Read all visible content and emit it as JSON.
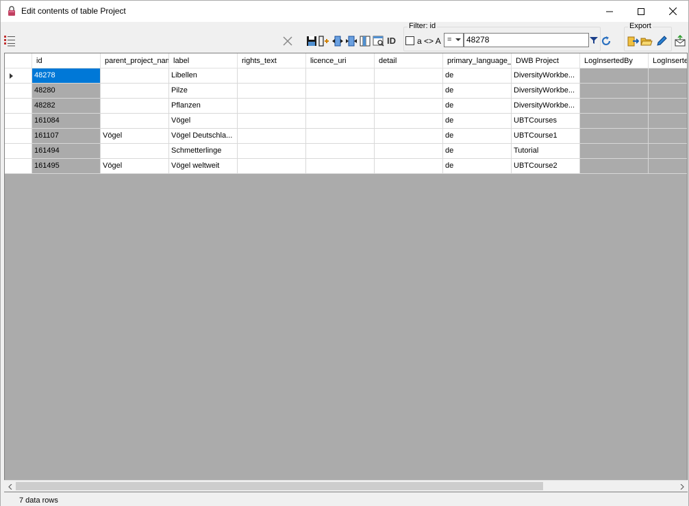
{
  "window": {
    "title": "Edit contents of table Project"
  },
  "toolbar": {
    "filter_group_title": "Filter: id",
    "case_checkbox_label": "a <> A",
    "case_checkbox_checked": false,
    "operator_value": "=",
    "filter_value": "48278",
    "id_button_label": "ID",
    "export_group_title": "Export"
  },
  "grid": {
    "columns": [
      "id",
      "parent_project_nam",
      "label",
      "rights_text",
      "licence_uri",
      "detail",
      "primary_language_c",
      "DWB Project",
      "LogInsertedBy",
      "LogInserte"
    ],
    "rows": [
      {
        "cells": [
          "48278",
          "",
          "Libellen",
          "",
          "",
          "",
          "de",
          "DiversityWorkbe...",
          "",
          ""
        ],
        "current": true
      },
      {
        "cells": [
          "48280",
          "",
          "Pilze",
          "",
          "",
          "",
          "de",
          "DiversityWorkbe...",
          "",
          ""
        ],
        "current": false
      },
      {
        "cells": [
          "48282",
          "",
          "Pflanzen",
          "",
          "",
          "",
          "de",
          "DiversityWorkbe...",
          "",
          ""
        ],
        "current": false
      },
      {
        "cells": [
          "161084",
          "",
          "Vögel",
          "",
          "",
          "",
          "de",
          "UBTCourses",
          "",
          ""
        ],
        "current": false
      },
      {
        "cells": [
          "161107",
          "Vögel",
          "Vögel Deutschla...",
          "",
          "",
          "",
          "de",
          "UBTCourse1",
          "",
          ""
        ],
        "current": false
      },
      {
        "cells": [
          "161494",
          "",
          "Schmetterlinge",
          "",
          "",
          "",
          "de",
          "Tutorial",
          "",
          ""
        ],
        "current": false
      },
      {
        "cells": [
          "161495",
          "Vögel",
          "Vögel weltweit",
          "",
          "",
          "",
          "de",
          "UBTCourse2",
          "",
          ""
        ],
        "current": false
      }
    ]
  },
  "status": {
    "text": "7 data rows"
  },
  "colors": {
    "selection": "#0078d7",
    "readonly_cell": "#ababab",
    "grid_background": "#ababab"
  }
}
